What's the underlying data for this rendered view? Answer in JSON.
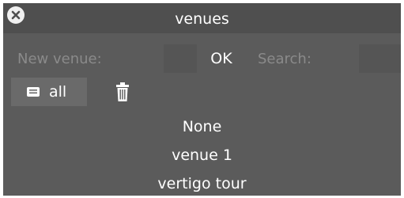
{
  "window": {
    "title": "venues",
    "close_icon": "close-icon"
  },
  "input_row": {
    "new_venue_placeholder": "New venue:",
    "new_venue_value": "",
    "ok_label": "OK",
    "search_placeholder": "Search:",
    "search_value": ""
  },
  "filter": {
    "all_label": "all",
    "all_icon": "list-icon",
    "trash_icon": "trash-icon"
  },
  "venues": [
    "None",
    "venue 1",
    "vertigo tour"
  ],
  "colors": {
    "window_bg": "#5b5b5b",
    "titlebar_bg": "#4f4f4f",
    "button_bg": "#6a6a6a",
    "text": "#ffffff",
    "placeholder": "#8a8a8a"
  }
}
